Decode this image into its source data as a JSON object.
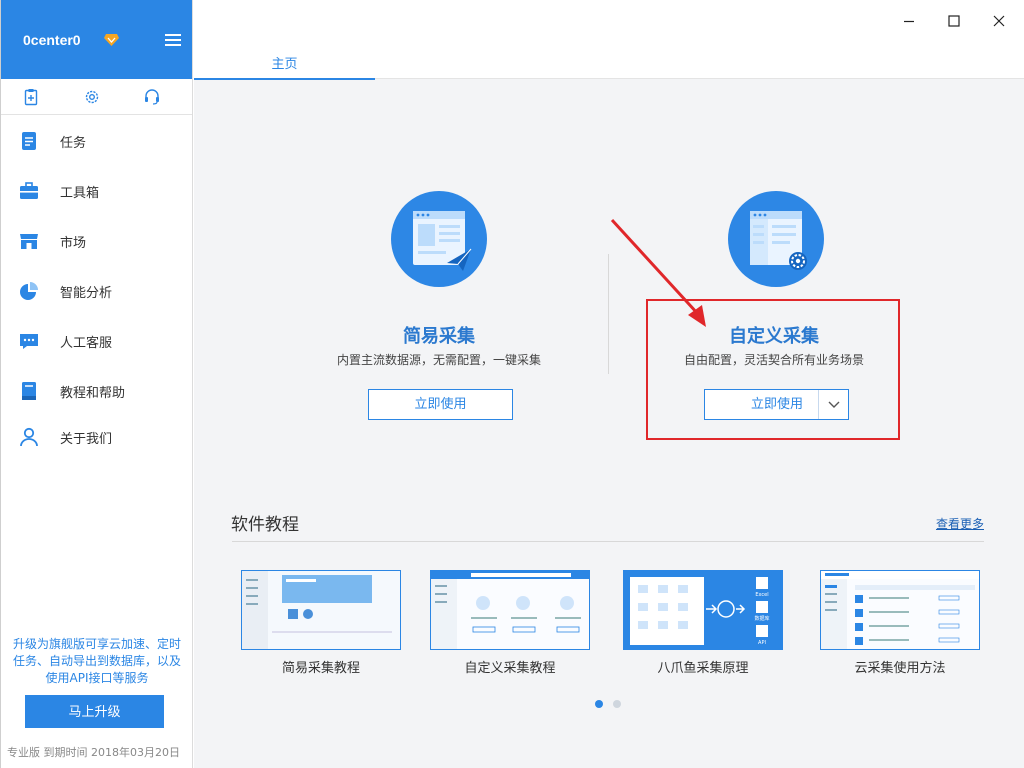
{
  "sidebar": {
    "username": "0center0",
    "nav": [
      {
        "label": "任务",
        "icon": "task-icon"
      },
      {
        "label": "工具箱",
        "icon": "toolbox-icon"
      },
      {
        "label": "市场",
        "icon": "market-icon"
      },
      {
        "label": "智能分析",
        "icon": "pie-chart-icon"
      },
      {
        "label": "人工客服",
        "icon": "chat-icon"
      },
      {
        "label": "教程和帮助",
        "icon": "book-icon"
      },
      {
        "label": "关于我们",
        "icon": "person-icon"
      }
    ],
    "promo": "升级为旗舰版可享云加速、定时任务、自动导出到数据库，以及使用API接口等服务",
    "upgrade_label": "马上升级",
    "footer": "专业版  到期时间 2018年03月20日"
  },
  "topbar": {
    "tab_home": "主页"
  },
  "cards": [
    {
      "title": "简易采集",
      "desc": "内置主流数据源，无需配置，一键采集",
      "button": "立即使用"
    },
    {
      "title": "自定义采集",
      "desc": "自由配置，灵活契合所有业务场景",
      "button": "立即使用"
    }
  ],
  "tutorials": {
    "section_title": "软件教程",
    "more_label": "查看更多",
    "items": [
      {
        "label": "简易采集教程"
      },
      {
        "label": "自定义采集教程"
      },
      {
        "label": "八爪鱼采集原理"
      },
      {
        "label": "云采集使用方法"
      }
    ],
    "thumb3": {
      "excel": "Excel",
      "db": "数据库",
      "api": "API"
    }
  },
  "colors": {
    "accent": "#2b86e4",
    "highlight": "#e0272a"
  }
}
